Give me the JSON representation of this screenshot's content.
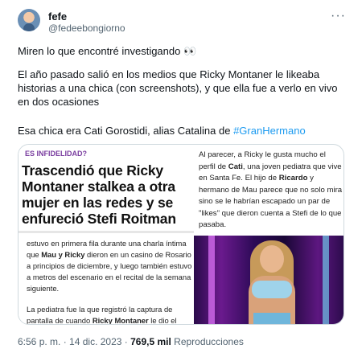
{
  "author": {
    "name": "fefe",
    "handle": "@fedeebongiorno",
    "more": "···"
  },
  "tweet": {
    "line1": "Miren lo que encontré investigando 👀",
    "line2": "El año pasado salió en los medios que Ricky Montaner le likeaba historias a una chica (con screenshots), y que ella fue a verlo en vivo en dos ocasiones",
    "line3_prefix": "Esa chica era Cati Gorostidi, alias Catalina de ",
    "hashtag": "#GranHermano"
  },
  "article": {
    "kicker": "ES INFIDELIDAD?",
    "headline": "Trascendió que Ricky Montaner stalkea a otra mujer en las redes y se enfureció Stefi Roitman",
    "body1_a": "estuvo en primera fila durante una charla íntima que ",
    "body1_b": "Mau y Ricky",
    "body1_c": " dieron en un casino de Rosario a principios de diciembre, y luego también estuvo a metros del escenario en el recital de la semana siguiente.",
    "body2_a": "La pediatra fue la que registró la captura de pantalla de cuando ",
    "body2_b": "Ricky Montaner",
    "body2_c": " le dio el",
    "right_a": "Al parecer, a Ricky le gusta mucho el perfil de ",
    "right_b": "Cati",
    "right_c": ", una joven pediatra que vive en Santa Fe. El hijo de ",
    "right_d": "Ricardo",
    "right_e": " y hermano de Mau parece que no solo mira sino se le habrían escapado un par de \"likes\" que dieron cuenta a Stefi de lo que pasaba."
  },
  "meta": {
    "time": "6:56 p. m.",
    "sep": " · ",
    "date": "14 dic. 2023",
    "views_count": "769,5 mil",
    "views_label": " Reproducciones"
  }
}
